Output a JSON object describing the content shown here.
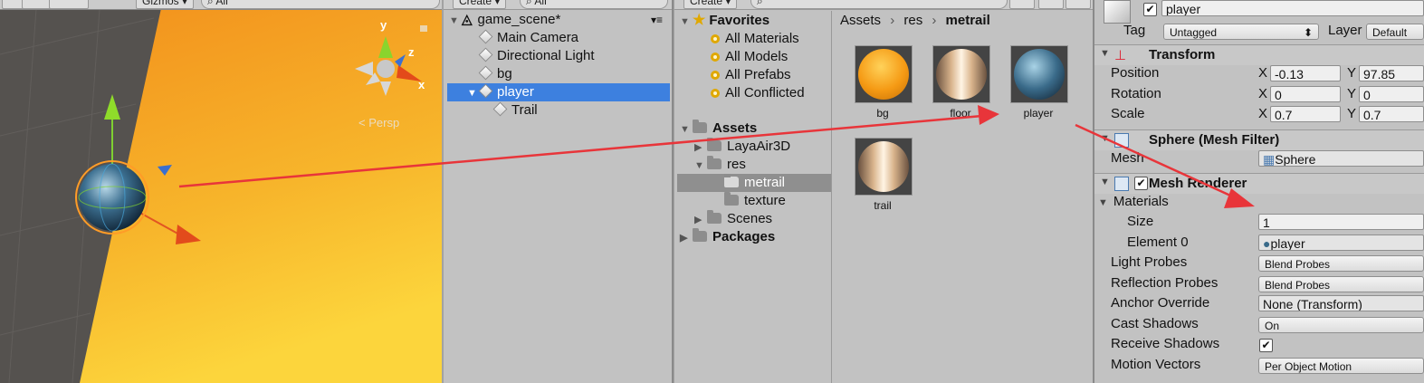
{
  "scene": {
    "toolbar_gizmos": "Gizmos",
    "toolbar_search_placeholder": "All",
    "persp_label": "Persp",
    "axis_y": "y",
    "axis_z": "z",
    "axis_x": "x"
  },
  "hierarchy": {
    "create_label": "Create",
    "search_placeholder": "All",
    "scene_name": "game_scene*",
    "items": [
      {
        "label": "Main Camera"
      },
      {
        "label": "Directional Light"
      },
      {
        "label": "bg"
      },
      {
        "label": "player",
        "selected": true
      },
      {
        "label": "Trail"
      }
    ]
  },
  "project": {
    "create_label": "Create",
    "favorites": {
      "label": "Favorites",
      "items": [
        "All Materials",
        "All Models",
        "All Prefabs",
        "All Conflicted"
      ]
    },
    "assets_label": "Assets",
    "tree": [
      "LayaAir3D",
      "res",
      "metrail",
      "texture",
      "Scenes"
    ],
    "packages_label": "Packages",
    "breadcrumb": [
      "Assets",
      "res",
      "metrail"
    ],
    "assets": [
      {
        "label": "bg",
        "color": "#f3a414"
      },
      {
        "label": "floor",
        "color": "#e8c9a4"
      },
      {
        "label": "player",
        "color": "#3a6b8a"
      },
      {
        "label": "trail",
        "color": "#e8c9a4"
      }
    ]
  },
  "inspector": {
    "object_name": "player",
    "tag_label": "Tag",
    "tag_value": "Untagged",
    "layer_label": "Layer",
    "layer_value": "Default",
    "transform": {
      "title": "Transform",
      "position_label": "Position",
      "rotation_label": "Rotation",
      "scale_label": "Scale",
      "x_label": "X",
      "y_label": "Y",
      "position_x": "-0.13",
      "position_y": "97.85",
      "rotation_x": "0",
      "rotation_y": "0",
      "scale_x": "0.7",
      "scale_y": "0.7"
    },
    "mesh_filter": {
      "title": "Sphere (Mesh Filter)",
      "mesh_label": "Mesh",
      "mesh_value": "Sphere"
    },
    "mesh_renderer": {
      "title": "Mesh Renderer",
      "materials_label": "Materials",
      "size_label": "Size",
      "size_value": "1",
      "element0_label": "Element 0",
      "element0_value": "player",
      "light_probes_label": "Light Probes",
      "light_probes_value": "Blend Probes",
      "reflection_probes_label": "Reflection Probes",
      "reflection_probes_value": "Blend Probes",
      "anchor_override_label": "Anchor Override",
      "anchor_override_value": "None (Transform)",
      "cast_shadows_label": "Cast Shadows",
      "cast_shadows_value": "On",
      "receive_shadows_label": "Receive Shadows",
      "receive_shadows_checked": true,
      "motion_vectors_label": "Motion Vectors",
      "motion_vectors_value": "Per Object Motion"
    }
  },
  "colors": {
    "selection": "#3d80df",
    "annotation_arrow": "#e8353a",
    "scene_orange": "#f59a1e"
  }
}
